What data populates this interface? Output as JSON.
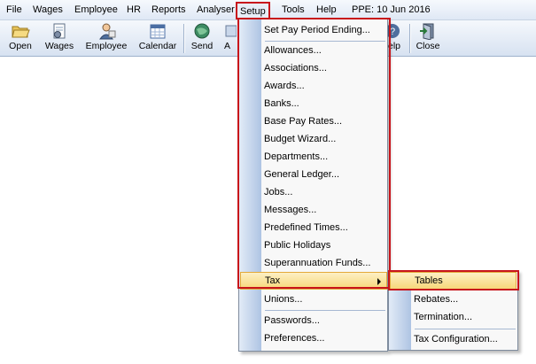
{
  "menubar": {
    "file": "File",
    "wages": "Wages",
    "employee": "Employee",
    "hr": "HR",
    "reports": "Reports",
    "analyser": "Analyser",
    "setup": "Setup",
    "tools": "Tools",
    "help": "Help",
    "ppe": "PPE:  10 Jun 2016"
  },
  "toolbar": {
    "open": "Open",
    "wages": "Wages",
    "employee": "Employee",
    "calendar": "Calendar",
    "send": "Send",
    "partial_a": "A",
    "help_partial": "elp",
    "close": "Close"
  },
  "setup_menu": {
    "items": [
      "Set Pay Period Ending...",
      "Allowances...",
      "Associations...",
      "Awards...",
      "Banks...",
      "Base Pay Rates...",
      "Budget Wizard...",
      "Departments...",
      "General Ledger...",
      "Jobs...",
      "Messages...",
      "Predefined Times...",
      "Public Holidays",
      "Superannuation Funds...",
      "Tax",
      "Unions...",
      "Passwords...",
      "Preferences..."
    ]
  },
  "tax_submenu": {
    "items": [
      "Tables",
      "Rebates...",
      "Termination...",
      "Tax Configuration..."
    ]
  },
  "colors": {
    "highlight_outline": "#c8151b",
    "hover_fill": "#f7d77a",
    "gutter": "#aec4e3"
  }
}
